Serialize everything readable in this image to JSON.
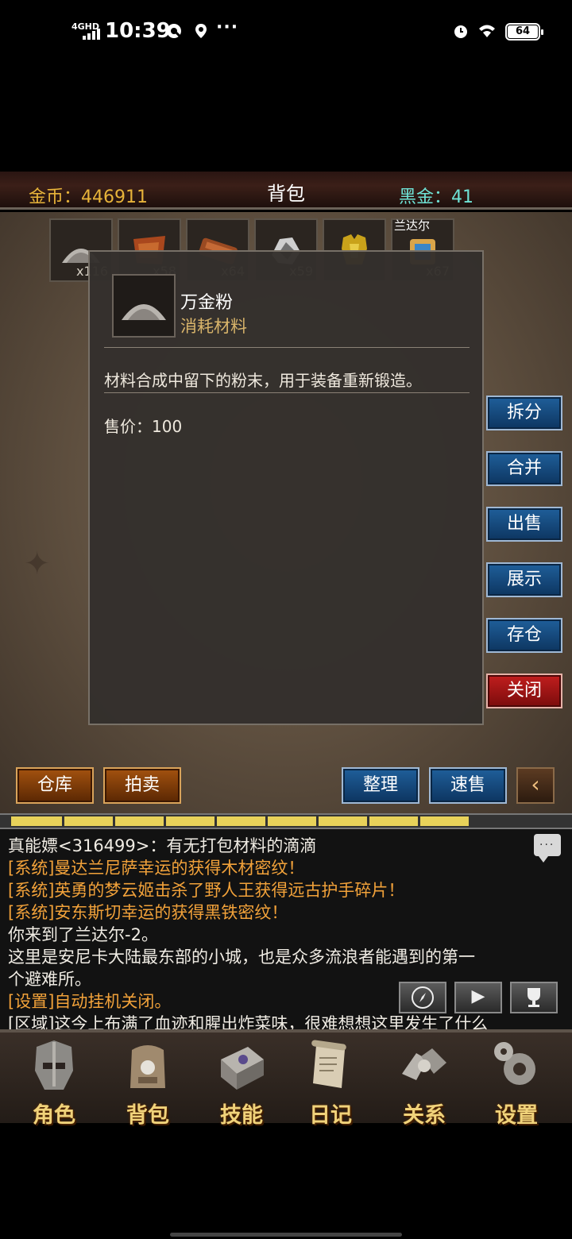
{
  "status_bar": {
    "network": "4GHD",
    "time": "10:39",
    "battery": "64",
    "dots": "···"
  },
  "header": {
    "gold_label": "金币：446911",
    "title": "背包",
    "blackgold_label": "黑金：41"
  },
  "inventory": {
    "slots": [
      {
        "qty": "x116",
        "icon": "powder-icon"
      },
      {
        "qty": "x58",
        "icon": "leather-icon"
      },
      {
        "qty": "x64",
        "icon": "wood-icon"
      },
      {
        "qty": "x59",
        "icon": "ore-icon"
      },
      {
        "qty": "",
        "icon": "golden-armor-icon"
      },
      {
        "qty": "x67",
        "icon": "scroll-icon",
        "name": "兰达尔"
      }
    ]
  },
  "tooltip": {
    "item_name": "万金粉",
    "item_type": "消耗材料",
    "description": "材料合成中留下的粉末，用于装备重新锻造。",
    "price": "售价：100"
  },
  "actions": {
    "split": "拆分",
    "merge": "合并",
    "sell": "出售",
    "show": "展示",
    "store": "存仓",
    "close": "关闭"
  },
  "bottom_buttons": {
    "warehouse": "仓库",
    "auction": "拍卖",
    "sort": "整理",
    "quick_sell": "速售"
  },
  "progress": {
    "filled_segments": 9,
    "total_segments": 10
  },
  "chat": {
    "lines": [
      {
        "text": "真能嫖<316499>：有无打包材料的滴滴",
        "color": "white"
      },
      {
        "text": "[系统]曼达兰尼萨幸运的获得木材密纹！",
        "color": "orange"
      },
      {
        "text": "[系统]英勇的梦云姬击杀了野人王获得远古护手碎片！",
        "color": "orange"
      },
      {
        "text": "[系统]安东斯切幸运的获得黑铁密纹！",
        "color": "orange"
      },
      {
        "text": "你来到了兰达尔-2。",
        "color": "white"
      },
      {
        "text": "这里是安尼卡大陆最东部的小城，也是众多流浪者能遇到的第一",
        "color": "white"
      },
      {
        "text": "个避难所。",
        "color": "white"
      },
      {
        "text": "[设置]自动挂机关闭。",
        "color": "orange"
      },
      {
        "text": "[区域]这今上布满了血迹和腥出炸菜味，很难想想这里发生了什么",
        "color": "white"
      }
    ]
  },
  "nav": {
    "items": [
      {
        "label": "角色",
        "icon": "helmet-icon"
      },
      {
        "label": "背包",
        "icon": "backpack-icon"
      },
      {
        "label": "技能",
        "icon": "skill-book-icon"
      },
      {
        "label": "日记",
        "icon": "scroll-diary-icon"
      },
      {
        "label": "关系",
        "icon": "handshake-icon"
      },
      {
        "label": "设置",
        "icon": "gears-icon"
      }
    ]
  },
  "colors": {
    "gold_text": "#e8b43a",
    "blackgold_text": "#6fe3d6",
    "system_text": "#f2a23a",
    "blue_button": "#1f5f9a",
    "red_button": "#c21e1e"
  }
}
